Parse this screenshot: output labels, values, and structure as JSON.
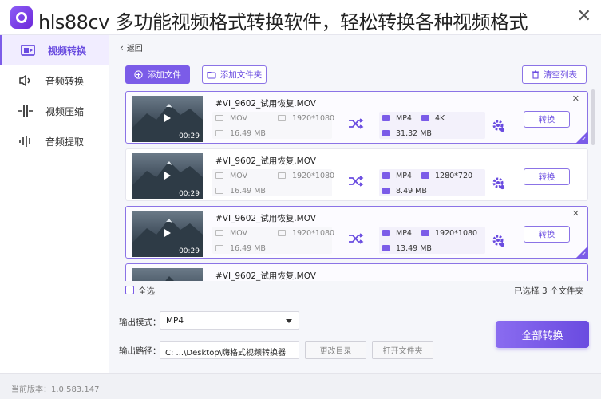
{
  "titlebar": {
    "app_name": "hls88cv 多功能视频格式转换软件，轻松转换各种视频格式",
    "close_glyph": "✕"
  },
  "sidebar": {
    "items": [
      {
        "label": "视频转换",
        "icon": "video-convert-icon",
        "active": true
      },
      {
        "label": "音频转换",
        "icon": "audio-convert-icon",
        "active": false
      },
      {
        "label": "视频压缩",
        "icon": "video-compress-icon",
        "active": false
      },
      {
        "label": "音频提取",
        "icon": "audio-extract-icon",
        "active": false
      }
    ]
  },
  "header": {
    "back_label": "返回"
  },
  "toolbar": {
    "add_file": "添加文件",
    "add_folder": "添加文件夹",
    "clear_list": "清空列表"
  },
  "files": [
    {
      "name": "#VI_9602_试用恢复.MOV",
      "duration": "00:29",
      "src_format": "MOV",
      "src_res": "1920*1080",
      "src_size": "16.49 MB",
      "out_format": "MP4",
      "out_res": "4K",
      "out_size": "31.32 MB",
      "convert_label": "转换",
      "selected": true
    },
    {
      "name": "#VI_9602_试用恢复.MOV",
      "duration": "00:29",
      "src_format": "MOV",
      "src_res": "1920*1080",
      "src_size": "16.49 MB",
      "out_format": "MP4",
      "out_res": "1280*720",
      "out_size": "8.49 MB",
      "convert_label": "转换",
      "selected": false
    },
    {
      "name": "#VI_9602_试用恢复.MOV",
      "duration": "00:29",
      "src_format": "MOV",
      "src_res": "1920*1080",
      "src_size": "16.49 MB",
      "out_format": "MP4",
      "out_res": "1920*1080",
      "out_size": "13.49 MB",
      "convert_label": "转换",
      "selected": true
    },
    {
      "name": "#VI_9602_试用恢复.MOV",
      "duration": "",
      "src_format": "",
      "src_res": "",
      "src_size": "",
      "out_format": "",
      "out_res": "",
      "out_size": "",
      "convert_label": "",
      "selected": true
    }
  ],
  "selection": {
    "select_all": "全选",
    "count_text": "已选择 3 个文件夹"
  },
  "output": {
    "mode_label": "输出模式：",
    "mode_value": "MP4",
    "path_label": "输出路径：",
    "path_value": "C: ...\\Desktop\\嗨格式视频转换器",
    "change_dir": "更改目录",
    "open_folder": "打开文件夹",
    "convert_all": "全部转换"
  },
  "footer": {
    "version": "当前版本：1.0.583.147"
  },
  "colors": {
    "accent": "#7b5ce8",
    "accent_dark": "#6a4be0"
  }
}
